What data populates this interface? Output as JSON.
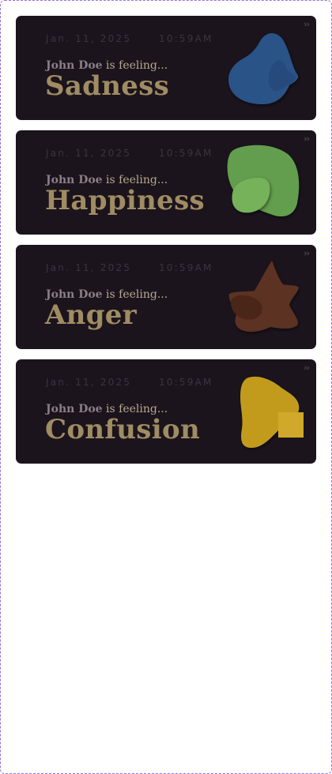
{
  "cards": [
    {
      "date": "Jan. 11, 2025",
      "time": "10:59AM",
      "name": "John Doe",
      "feeling_text": " is feeling...",
      "emotion": "Sadness",
      "expand_icon": "double-chevron-right-icon",
      "color": "#2b5287"
    },
    {
      "date": "Jan. 11, 2025",
      "time": "10:59AM",
      "name": "John Doe",
      "feeling_text": " is feeling...",
      "emotion": "Happiness",
      "expand_icon": "double-chevron-right-icon",
      "color": "#629e4d"
    },
    {
      "date": "Jan. 11, 2025",
      "time": "10:59AM",
      "name": "John Doe",
      "feeling_text": " is feeling...",
      "emotion": "Anger",
      "expand_icon": "double-chevron-right-icon",
      "color": "#5c3122"
    },
    {
      "date": "Jan. 11, 2025",
      "time": "10:59AM",
      "name": "John Doe",
      "feeling_text": " is feeling...",
      "emotion": "Confusion",
      "expand_icon": "double-chevron-right-icon",
      "color": "#c29b1d"
    }
  ],
  "expand_glyph": "››"
}
